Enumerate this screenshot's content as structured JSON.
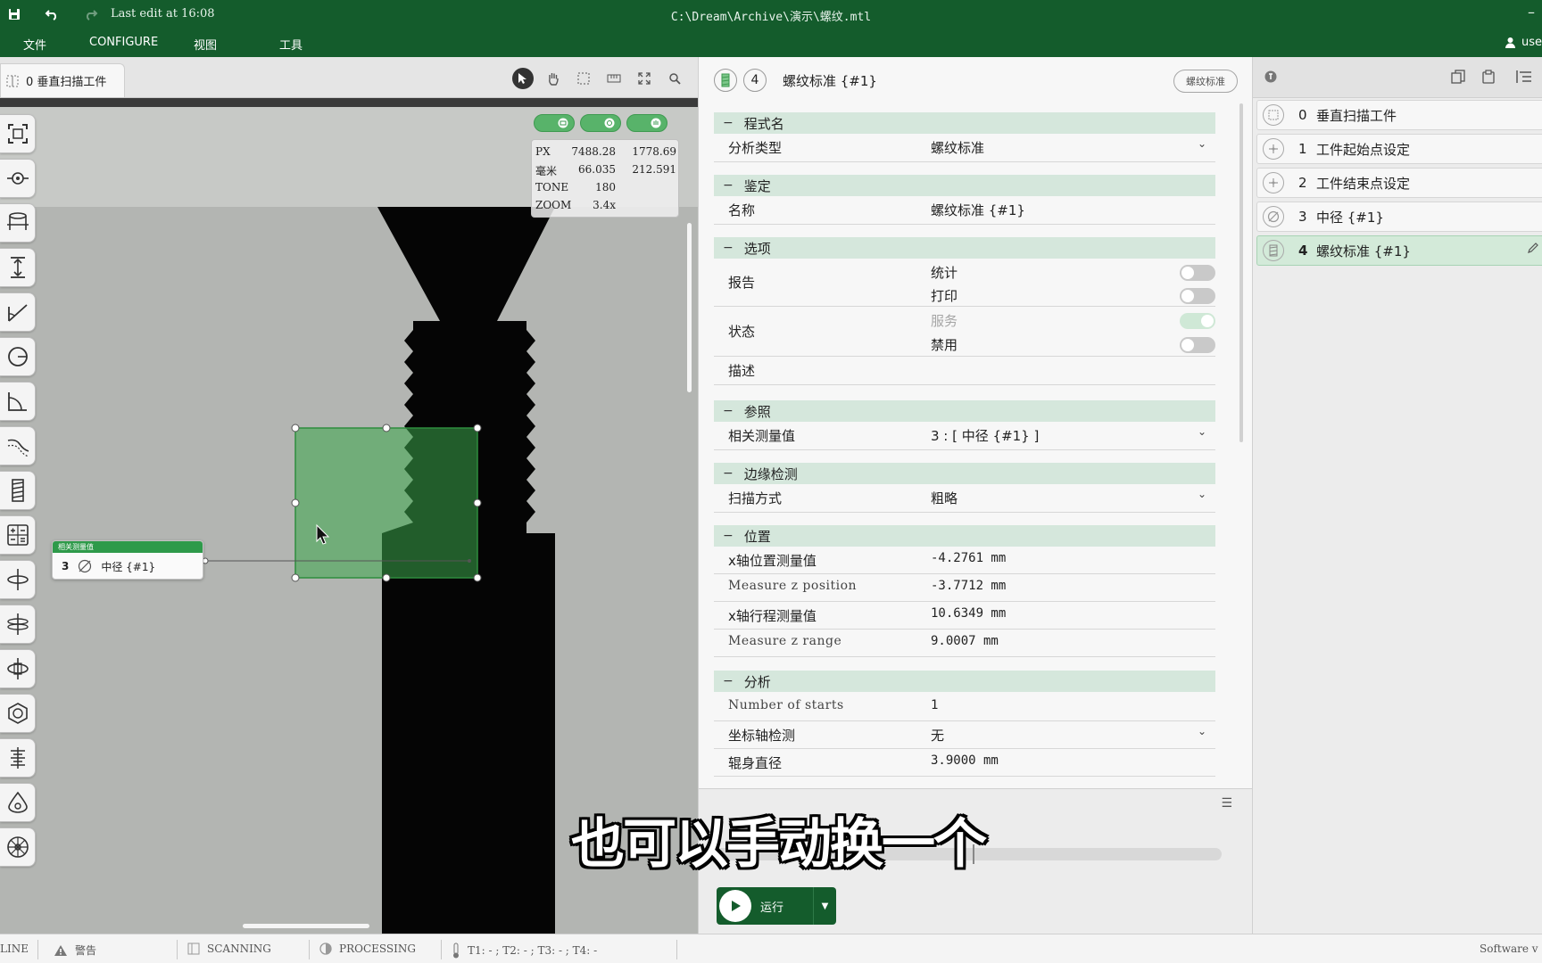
{
  "titlebar": {
    "last_edit": "Last edit at 16:08",
    "path": "C:\\Dream\\Archive\\演示\\螺纹.mtl",
    "minimize": "–"
  },
  "menu": {
    "items": [
      "文件",
      "CONFIGURE",
      "视图",
      "工具"
    ],
    "user": "use"
  },
  "left_tab": {
    "label": "0 垂直扫描工件"
  },
  "readout": {
    "rows": [
      {
        "label": "PX",
        "v1": "7488.28",
        "v2": "1778.69"
      },
      {
        "label": "毫米",
        "v1": "66.035",
        "v2": "212.591"
      },
      {
        "label": "TONE",
        "v1": "180",
        "v2": ""
      },
      {
        "label": "ZOOM",
        "v1": "3.4x",
        "v2": ""
      }
    ]
  },
  "ref_card": {
    "header": "相关测量值",
    "num": "3",
    "name": "中径 {#1}"
  },
  "props": {
    "header": {
      "num": "4",
      "title": "螺纹标准 {#1}",
      "badge": "螺纹标准"
    },
    "sections": {
      "program": "程式名",
      "identify": "鉴定",
      "options": "选项",
      "reference": "参照",
      "edge": "边缘检测",
      "position": "位置",
      "analysis": "分析"
    },
    "analysis_type": {
      "label": "分析类型",
      "value": "螺纹标准"
    },
    "name": {
      "label": "名称",
      "value": "螺纹标准 {#1}"
    },
    "report": {
      "label": "报告",
      "opt1": "统计",
      "opt2": "打印"
    },
    "status": {
      "label": "状态",
      "opt1": "服务",
      "opt2": "禁用"
    },
    "desc": {
      "label": "描述"
    },
    "related": {
      "label": "相关测量值",
      "value": "3 : [ 中径 {#1} ]"
    },
    "scan": {
      "label": "扫描方式",
      "value": "粗略"
    },
    "x_pos": {
      "label": "x轴位置测量值",
      "value": "-4.2761 mm"
    },
    "z_pos": {
      "label": "Measure z position",
      "value": "-3.7712 mm"
    },
    "x_range": {
      "label": "x轴行程测量值",
      "value": "10.6349 mm"
    },
    "z_range": {
      "label": "Measure z range",
      "value": "9.0007 mm"
    },
    "starts": {
      "label": "Number of starts",
      "value": "1"
    },
    "axis": {
      "label": "坐标轴检测",
      "value": "无"
    },
    "shank": {
      "label": "辊身直径",
      "value": "3.9000 mm"
    },
    "run": "运行"
  },
  "tree": {
    "items": [
      {
        "num": "0",
        "name": "垂直扫描工件"
      },
      {
        "num": "1",
        "name": "工件起始点设定"
      },
      {
        "num": "2",
        "name": "工件结束点设定"
      },
      {
        "num": "3",
        "name": "中径 {#1}"
      },
      {
        "num": "4",
        "name": "螺纹标准 {#1}"
      }
    ]
  },
  "statusbar": {
    "line": "LINE",
    "warning": "警告",
    "scanning": "SCANNING",
    "processing": "PROCESSING",
    "temps": "T1: - ; T2: - ; T3: - ; T4: -",
    "software": "Software v"
  },
  "subtitle": "也可以手动换一个",
  "colors": {
    "brand": "#145c2c",
    "accent": "#2e9a4a",
    "section": "#d5e7dc"
  }
}
